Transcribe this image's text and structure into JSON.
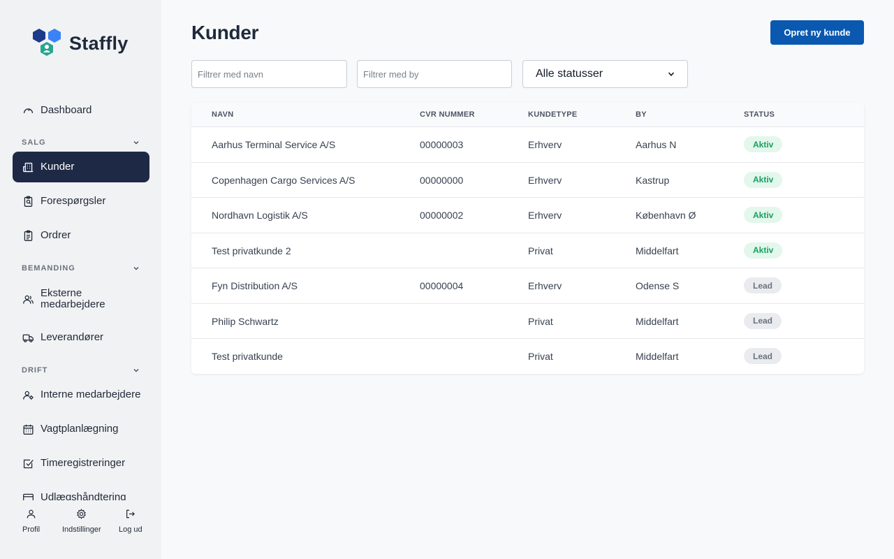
{
  "app": {
    "name": "Staffly"
  },
  "sidebar": {
    "dashboard": "Dashboard",
    "sections": [
      {
        "label": "SALG"
      },
      {
        "label": "BEMANDING"
      },
      {
        "label": "DRIFT"
      }
    ],
    "items": {
      "kunder": "Kunder",
      "forespoergsler": "Forespørgsler",
      "ordrer": "Ordrer",
      "eksterne_line1": "Eksterne",
      "eksterne_line2": "medarbejdere",
      "leverandoerer": "Leverandører",
      "interne": "Interne medarbejdere",
      "vagtplan": "Vagtplanlægning",
      "timereg": "Timeregistreringer",
      "udlaeg": "Udlægshåndtering"
    },
    "active": "Kunder",
    "bottom": {
      "profil": "Profil",
      "indstillinger": "Indstillinger",
      "logud": "Log ud"
    }
  },
  "main": {
    "title": "Kunder",
    "create_button": "Opret ny kunde",
    "filters": {
      "name_placeholder": "Filtrer med navn",
      "city_placeholder": "Filtrer med by",
      "status_selected": "Alle statusser"
    },
    "table": {
      "columns": [
        "NAVN",
        "CVR NUMMER",
        "KUNDETYPE",
        "BY",
        "STATUS"
      ],
      "rows": [
        {
          "navn": "Aarhus Terminal Service A/S",
          "cvr": "00000003",
          "type": "Erhverv",
          "by": "Aarhus N",
          "status": "Aktiv"
        },
        {
          "navn": "Copenhagen Cargo Services A/S",
          "cvr": "00000000",
          "type": "Erhverv",
          "by": "Kastrup",
          "status": "Aktiv"
        },
        {
          "navn": "Nordhavn Logistik A/S",
          "cvr": "00000002",
          "type": "Erhverv",
          "by": "København Ø",
          "status": "Aktiv"
        },
        {
          "navn": "Test privatkunde 2",
          "cvr": "",
          "type": "Privat",
          "by": "Middelfart",
          "status": "Aktiv"
        },
        {
          "navn": "Fyn Distribution A/S",
          "cvr": "00000004",
          "type": "Erhverv",
          "by": "Odense S",
          "status": "Lead"
        },
        {
          "navn": "Philip Schwartz",
          "cvr": "",
          "type": "Privat",
          "by": "Middelfart",
          "status": "Lead"
        },
        {
          "navn": "Test privatkunde",
          "cvr": "",
          "type": "Privat",
          "by": "Middelfart",
          "status": "Lead"
        }
      ]
    }
  },
  "colors": {
    "sidebar_active": "#1e2a45",
    "primary": "#0a58b0",
    "status_aktiv": "#16a060",
    "status_lead": "#6b7280"
  }
}
